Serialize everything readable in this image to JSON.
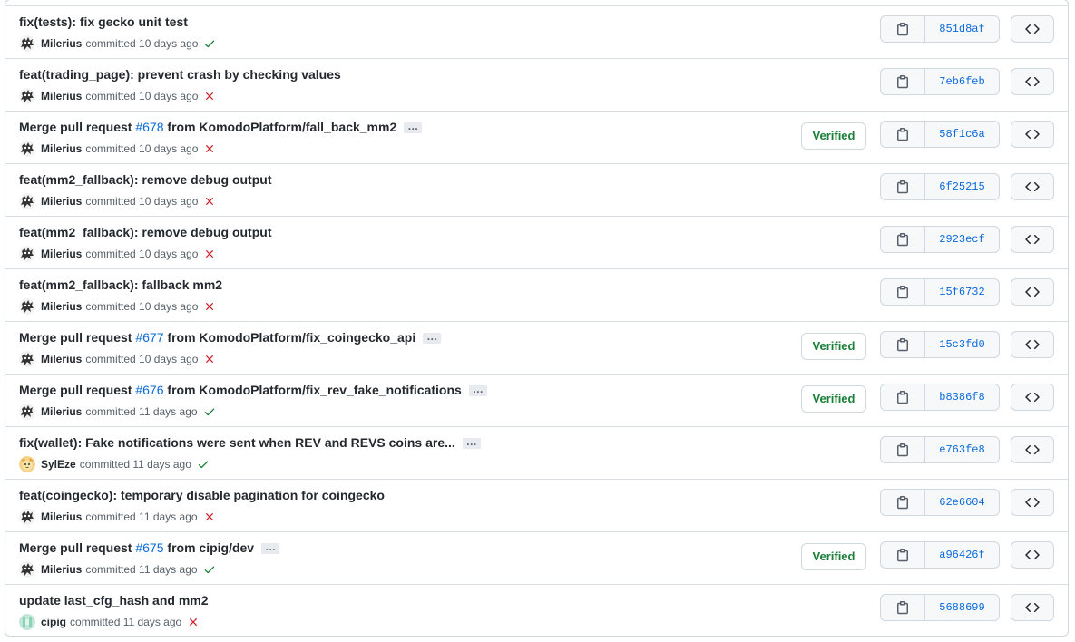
{
  "commits": [
    {
      "title": "fix(tests): fix gecko unit test",
      "pr": "",
      "title_suffix": "",
      "author": "Milerius",
      "time": "committed 10 days ago",
      "status": "success",
      "verified": false,
      "sha": "851d8af",
      "avatar": "milerius",
      "ellipsis": false
    },
    {
      "title": "feat(trading_page): prevent crash by checking values",
      "pr": "",
      "title_suffix": "",
      "author": "Milerius",
      "time": "committed 10 days ago",
      "status": "failure",
      "verified": false,
      "sha": "7eb6feb",
      "avatar": "milerius",
      "ellipsis": false
    },
    {
      "title": "Merge pull request ",
      "pr": "#678",
      "title_suffix": " from KomodoPlatform/fall_back_mm2",
      "author": "Milerius",
      "time": "committed 10 days ago",
      "status": "failure",
      "verified": true,
      "sha": "58f1c6a",
      "avatar": "milerius",
      "ellipsis": true
    },
    {
      "title": "feat(mm2_fallback): remove debug output",
      "pr": "",
      "title_suffix": "",
      "author": "Milerius",
      "time": "committed 10 days ago",
      "status": "failure",
      "verified": false,
      "sha": "6f25215",
      "avatar": "milerius",
      "ellipsis": false
    },
    {
      "title": "feat(mm2_fallback): remove debug output",
      "pr": "",
      "title_suffix": "",
      "author": "Milerius",
      "time": "committed 10 days ago",
      "status": "failure",
      "verified": false,
      "sha": "2923ecf",
      "avatar": "milerius",
      "ellipsis": false
    },
    {
      "title": "feat(mm2_fallback): fallback mm2",
      "pr": "",
      "title_suffix": "",
      "author": "Milerius",
      "time": "committed 10 days ago",
      "status": "failure",
      "verified": false,
      "sha": "15f6732",
      "avatar": "milerius",
      "ellipsis": false
    },
    {
      "title": "Merge pull request ",
      "pr": "#677",
      "title_suffix": " from KomodoPlatform/fix_coingecko_api",
      "author": "Milerius",
      "time": "committed 10 days ago",
      "status": "failure",
      "verified": true,
      "sha": "15c3fd0",
      "avatar": "milerius",
      "ellipsis": true
    },
    {
      "title": "Merge pull request ",
      "pr": "#676",
      "title_suffix": " from KomodoPlatform/fix_rev_fake_notifications",
      "author": "Milerius",
      "time": "committed 11 days ago",
      "status": "success",
      "verified": true,
      "sha": "b8386f8",
      "avatar": "milerius",
      "ellipsis": true
    },
    {
      "title": "fix(wallet): Fake notifications were sent when REV and REVS coins are...",
      "pr": "",
      "title_suffix": "",
      "author": "SylEze",
      "time": "committed 11 days ago",
      "status": "success",
      "verified": false,
      "sha": "e763fe8",
      "avatar": "syleze",
      "ellipsis": true
    },
    {
      "title": "feat(coingecko): temporary disable pagination for coingecko",
      "pr": "",
      "title_suffix": "",
      "author": "Milerius",
      "time": "committed 11 days ago",
      "status": "failure",
      "verified": false,
      "sha": "62e6604",
      "avatar": "milerius",
      "ellipsis": false
    },
    {
      "title": "Merge pull request ",
      "pr": "#675",
      "title_suffix": " from cipig/dev",
      "author": "Milerius",
      "time": "committed 11 days ago",
      "status": "success",
      "verified": true,
      "sha": "a96426f",
      "avatar": "milerius",
      "ellipsis": true
    },
    {
      "title": "update last_cfg_hash and mm2",
      "pr": "",
      "title_suffix": "",
      "author": "cipig",
      "time": "committed 11 days ago",
      "status": "failure",
      "verified": false,
      "sha": "5688699",
      "avatar": "cipig",
      "ellipsis": false
    }
  ],
  "labels": {
    "verified": "Verified",
    "ellipsis": "…"
  },
  "colors": {
    "link": "#0969da",
    "success": "#1a7f37",
    "failure": "#cf222e",
    "border": "#d0d7de"
  },
  "icons": {
    "copy": "clipboard-icon",
    "browse": "code-icon",
    "success": "check-icon",
    "failure": "x-icon"
  }
}
